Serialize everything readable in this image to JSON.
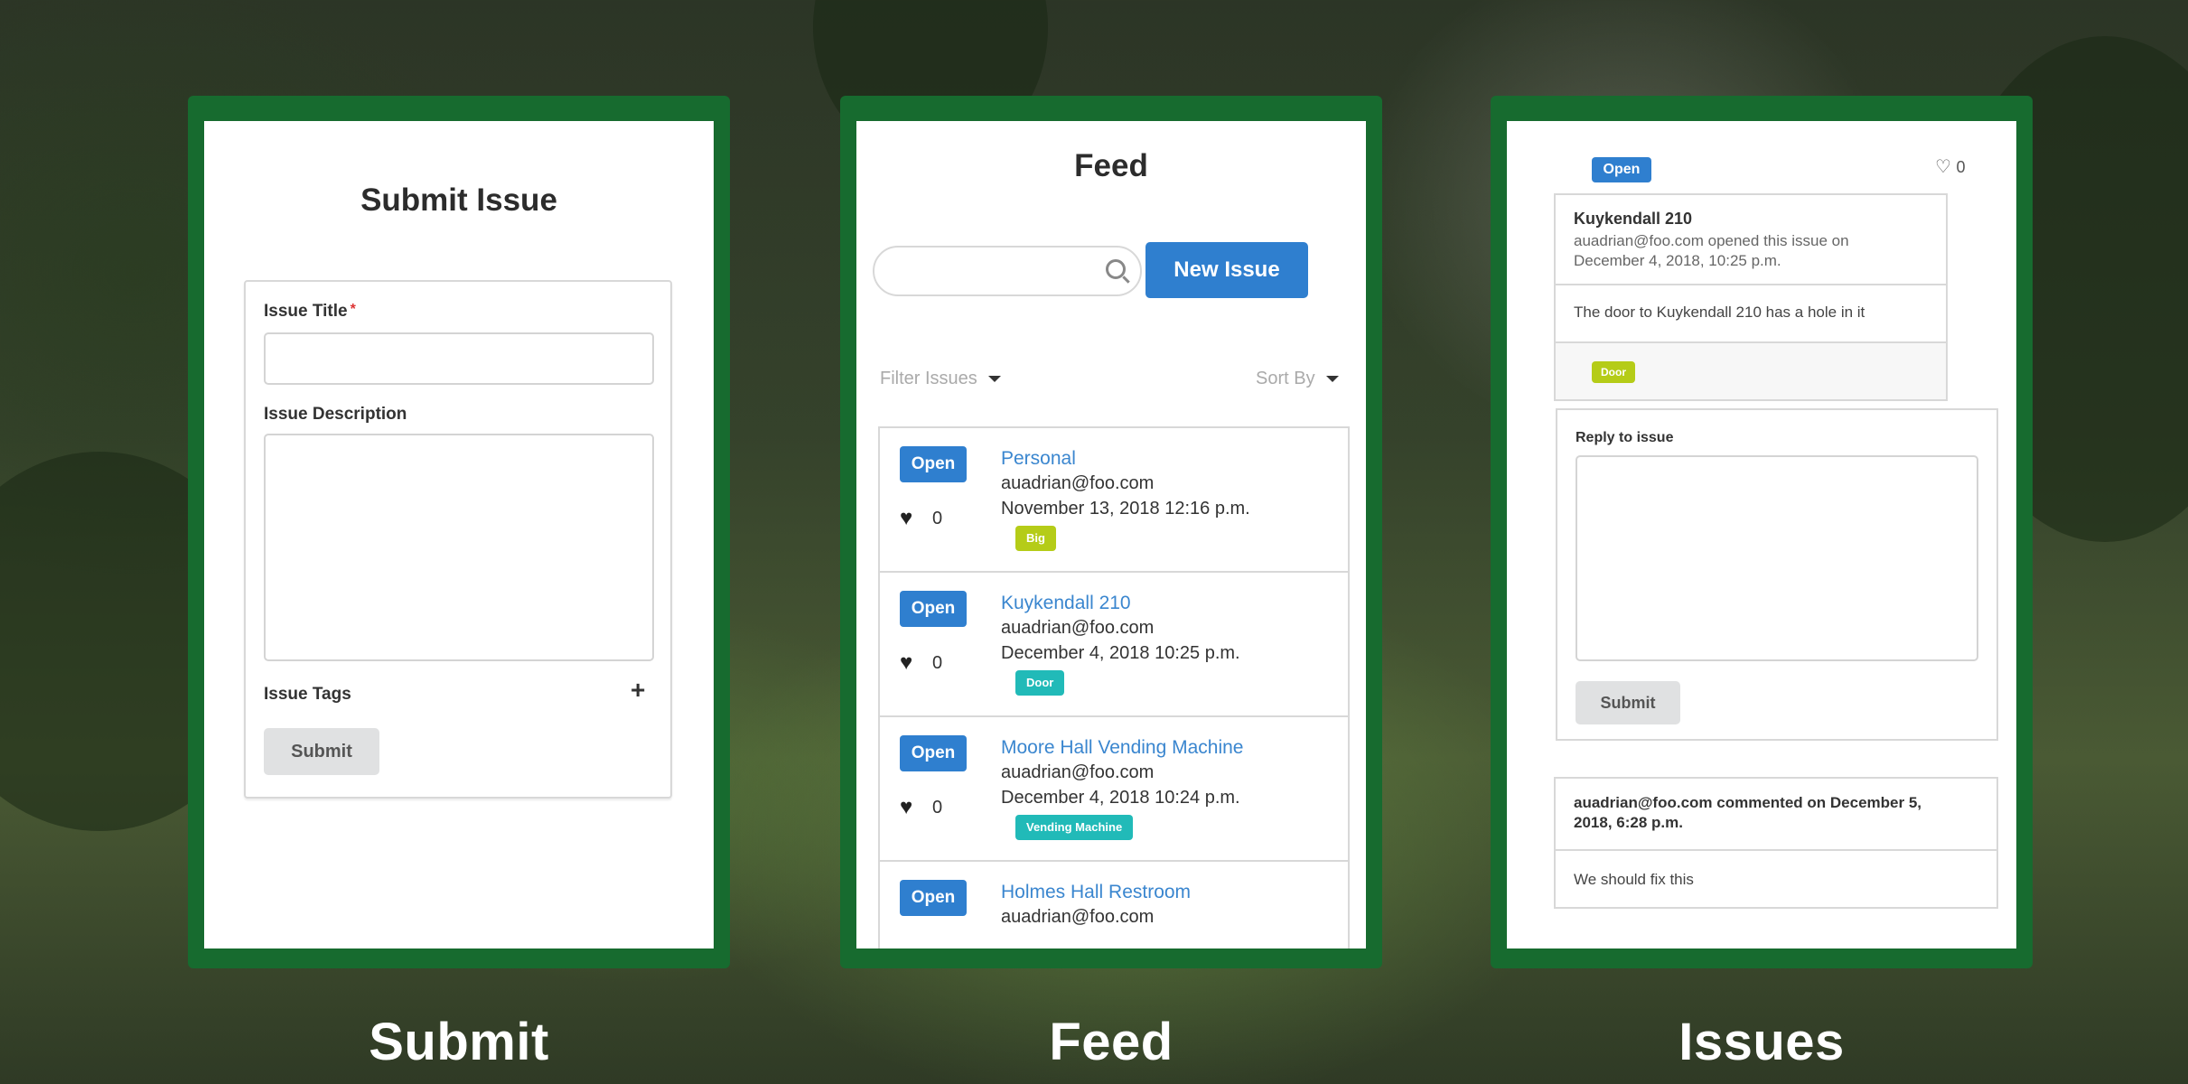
{
  "captions": [
    "Submit",
    "Feed",
    "Issues"
  ],
  "colors": {
    "frame": "#176b2f",
    "primary": "#2f7fcf",
    "tag_big": "#b5cc18",
    "tag_door": "#21bab8",
    "tag_vending": "#21bab8"
  },
  "submit": {
    "title": "Submit Issue",
    "issue_title_label": "Issue Title",
    "required_mark": "*",
    "description_label": "Issue Description",
    "tags_label": "Issue Tags",
    "add_tag_icon": "+",
    "submit_label": "Submit"
  },
  "feed": {
    "title": "Feed",
    "search_placeholder": "",
    "new_issue_label": "New Issue",
    "filter_label": "Filter Issues",
    "sort_label": "Sort By",
    "issues": [
      {
        "status": "Open",
        "likes": "0",
        "title": "Personal",
        "user": "auadrian@foo.com",
        "date": "November 13, 2018 12:16 p.m.",
        "tag": "Big"
      },
      {
        "status": "Open",
        "likes": "0",
        "title": "Kuykendall 210",
        "user": "auadrian@foo.com",
        "date": "December 4, 2018 10:25 p.m.",
        "tag": "Door"
      },
      {
        "status": "Open",
        "likes": "0",
        "title": "Moore Hall Vending Machine",
        "user": "auadrian@foo.com",
        "date": "December 4, 2018 10:24 p.m.",
        "tag": "Vending Machine"
      },
      {
        "status": "Open",
        "likes": "",
        "title": "Holmes Hall Restroom",
        "user": "auadrian@foo.com",
        "date": "",
        "tag": ""
      }
    ]
  },
  "issues": {
    "status": "Open",
    "likes": "0",
    "title": "Kuykendall 210",
    "opened_by": "auadrian@foo.com opened this issue on December 4, 2018, 10:25 p.m.",
    "description": "The door to Kuykendall 210 has a hole in it",
    "tag": "Door",
    "reply_label": "Reply to issue",
    "submit_label": "Submit",
    "comment_header": "auadrian@foo.com commented on December 5, 2018, 6:28 p.m.",
    "comment_body": "We should fix this"
  }
}
